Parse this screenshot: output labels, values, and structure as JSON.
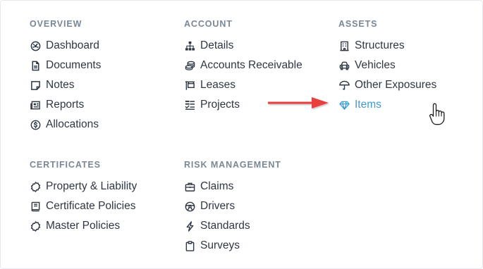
{
  "overview": {
    "title": "OVERVIEW",
    "items": [
      {
        "label": "Dashboard",
        "icon": "dashboard-icon"
      },
      {
        "label": "Documents",
        "icon": "document-icon"
      },
      {
        "label": "Notes",
        "icon": "note-icon"
      },
      {
        "label": "Reports",
        "icon": "newspaper-icon"
      },
      {
        "label": "Allocations",
        "icon": "dollar-circle-icon"
      }
    ]
  },
  "account": {
    "title": "ACCOUNT",
    "items": [
      {
        "label": "Details",
        "icon": "sitemap-icon"
      },
      {
        "label": "Accounts Receivable",
        "icon": "coins-icon"
      },
      {
        "label": "Leases",
        "icon": "sign-icon"
      },
      {
        "label": "Projects",
        "icon": "tasks-icon"
      }
    ]
  },
  "assets": {
    "title": "ASSETS",
    "items": [
      {
        "label": "Structures",
        "icon": "building-icon"
      },
      {
        "label": "Vehicles",
        "icon": "car-icon"
      },
      {
        "label": "Other Exposures",
        "icon": "umbrella-icon"
      },
      {
        "label": "Items",
        "icon": "gem-icon",
        "active": true
      }
    ]
  },
  "certificates": {
    "title": "CERTIFICATES",
    "items": [
      {
        "label": "Property & Liability",
        "icon": "certificate-icon"
      },
      {
        "label": "Certificate Policies",
        "icon": "book-icon"
      },
      {
        "label": "Master Policies",
        "icon": "certificate-icon"
      }
    ]
  },
  "risk_management": {
    "title": "RISK MANAGEMENT",
    "items": [
      {
        "label": "Claims",
        "icon": "briefcase-icon"
      },
      {
        "label": "Drivers",
        "icon": "steering-wheel-icon"
      },
      {
        "label": "Standards",
        "icon": "lightning-icon"
      },
      {
        "label": "Surveys",
        "icon": "clipboard-icon"
      }
    ]
  },
  "colors": {
    "text": "#2f3743",
    "section_title": "#7a8796",
    "active": "#3f9bd2",
    "arrow": "#e8413c"
  }
}
